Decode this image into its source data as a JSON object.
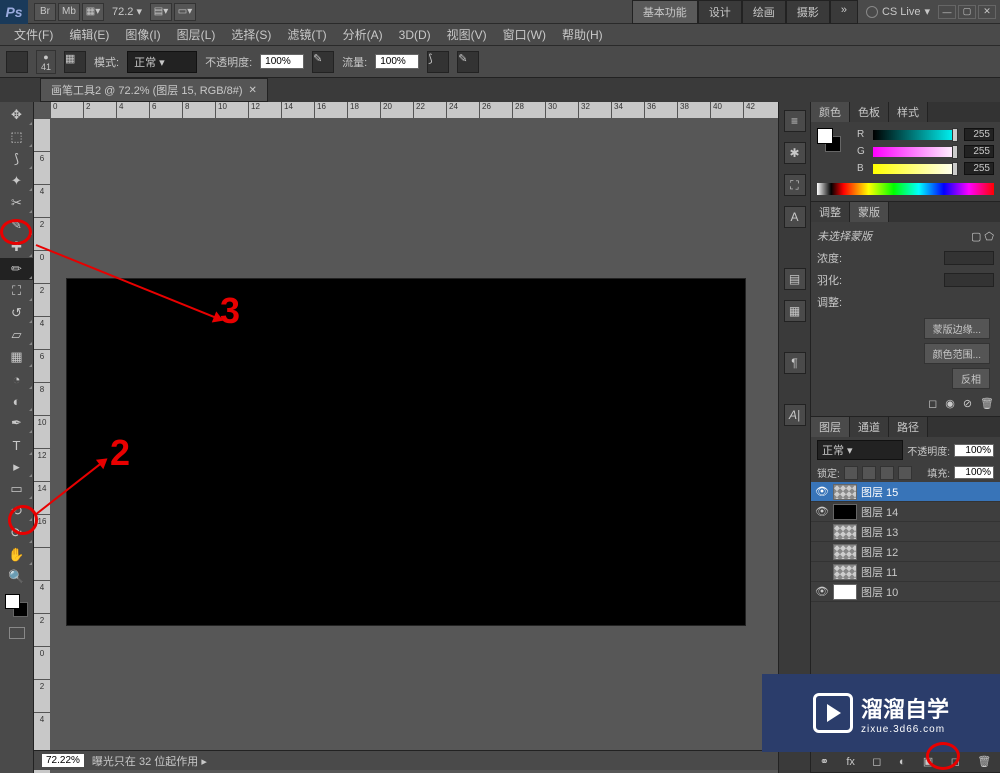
{
  "top": {
    "zoom_value": "72.2",
    "workspace_tabs": [
      "基本功能",
      "设计",
      "绘画",
      "摄影"
    ],
    "cslive": "CS Live"
  },
  "menus": [
    "文件(F)",
    "编辑(E)",
    "图像(I)",
    "图层(L)",
    "选择(S)",
    "滤镜(T)",
    "分析(A)",
    "3D(D)",
    "视图(V)",
    "窗口(W)",
    "帮助(H)"
  ],
  "options": {
    "brush_size": "41",
    "mode_label": "模式:",
    "mode_value": "正常",
    "opacity_label": "不透明度:",
    "opacity_value": "100%",
    "flow_label": "流量:",
    "flow_value": "100%"
  },
  "doc_tab": "画笔工具2 @ 72.2% (图层 15, RGB/8#)",
  "ruler_h": [
    "0",
    "2",
    "4",
    "6",
    "8",
    "10",
    "12",
    "14",
    "16",
    "18",
    "20",
    "22",
    "24",
    "26",
    "28",
    "30",
    "32",
    "34",
    "36",
    "38",
    "40",
    "42"
  ],
  "ruler_v": [
    "",
    "6",
    "4",
    "2",
    "0",
    "2",
    "4",
    "6",
    "8",
    "10",
    "12",
    "14",
    "16",
    "",
    "4",
    "2",
    "0",
    "2",
    "4"
  ],
  "panels": {
    "color_tabs": [
      "颜色",
      "色板",
      "样式"
    ],
    "r_label": "R",
    "g_label": "G",
    "b_label": "B",
    "r_val": "255",
    "g_val": "255",
    "b_val": "255",
    "adjust_tabs": [
      "调整",
      "蒙版"
    ],
    "mask_unselected": "未选择蒙版",
    "density_label": "浓度:",
    "feather_label": "羽化:",
    "refine_label": "调整:",
    "mask_edge": "蒙版边缘...",
    "color_range": "颜色范围...",
    "invert": "反相",
    "layer_tabs": [
      "图层",
      "通道",
      "路径"
    ],
    "blend_mode": "正常",
    "opacity_lbl": "不透明度:",
    "opacity": "100%",
    "lock_lbl": "锁定:",
    "fill_lbl": "填充:",
    "fill": "100%",
    "layers": [
      {
        "name": "图层 15",
        "sel": true,
        "eye": true,
        "thumb": "trans"
      },
      {
        "name": "图层 14",
        "sel": false,
        "eye": true,
        "thumb": "black"
      },
      {
        "name": "图层 13",
        "sel": false,
        "eye": false,
        "thumb": "trans"
      },
      {
        "name": "图层 12",
        "sel": false,
        "eye": false,
        "thumb": "trans"
      },
      {
        "name": "图层 11",
        "sel": false,
        "eye": false,
        "thumb": "trans"
      },
      {
        "name": "图层 10",
        "sel": false,
        "eye": true,
        "thumb": "white"
      }
    ]
  },
  "status": {
    "zoom": "72.22%",
    "info": "曝光只在 32 位起作用"
  },
  "annotations": {
    "num2": "2",
    "num3": "3"
  },
  "watermark": {
    "title": "溜溜自学",
    "sub": "zixue.3d66.com"
  }
}
